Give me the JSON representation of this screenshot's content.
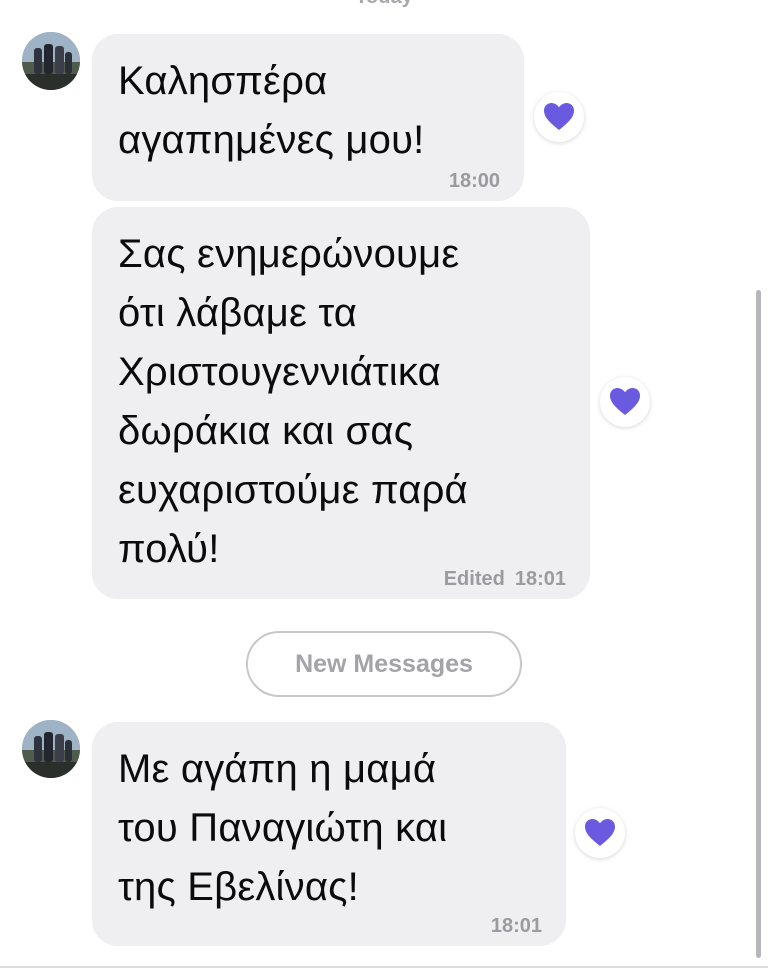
{
  "date_separator": "Today",
  "new_messages_label": "New Messages",
  "reaction_color": "#6a5ae0",
  "messages": [
    {
      "id": "m1",
      "text": "Καλησπέρα\nαγαπημένες μου!",
      "time": "18:00",
      "edited": "",
      "reaction": "heart-icon"
    },
    {
      "id": "m2",
      "text": "Σας ενημερώνουμε\nότι λάβαμε τα\nΧριστουγεννιάτικα\nδωράκια και σας\nευχαριστούμε παρά\nπολύ!",
      "time": "18:01",
      "edited": "Edited",
      "reaction": "heart-icon"
    },
    {
      "id": "m3",
      "text": "Με αγάπη η μαμά\nτου Παναγιώτη και\nτης Εβελίνας!",
      "time": "18:01",
      "edited": "",
      "reaction": "heart-icon"
    }
  ]
}
